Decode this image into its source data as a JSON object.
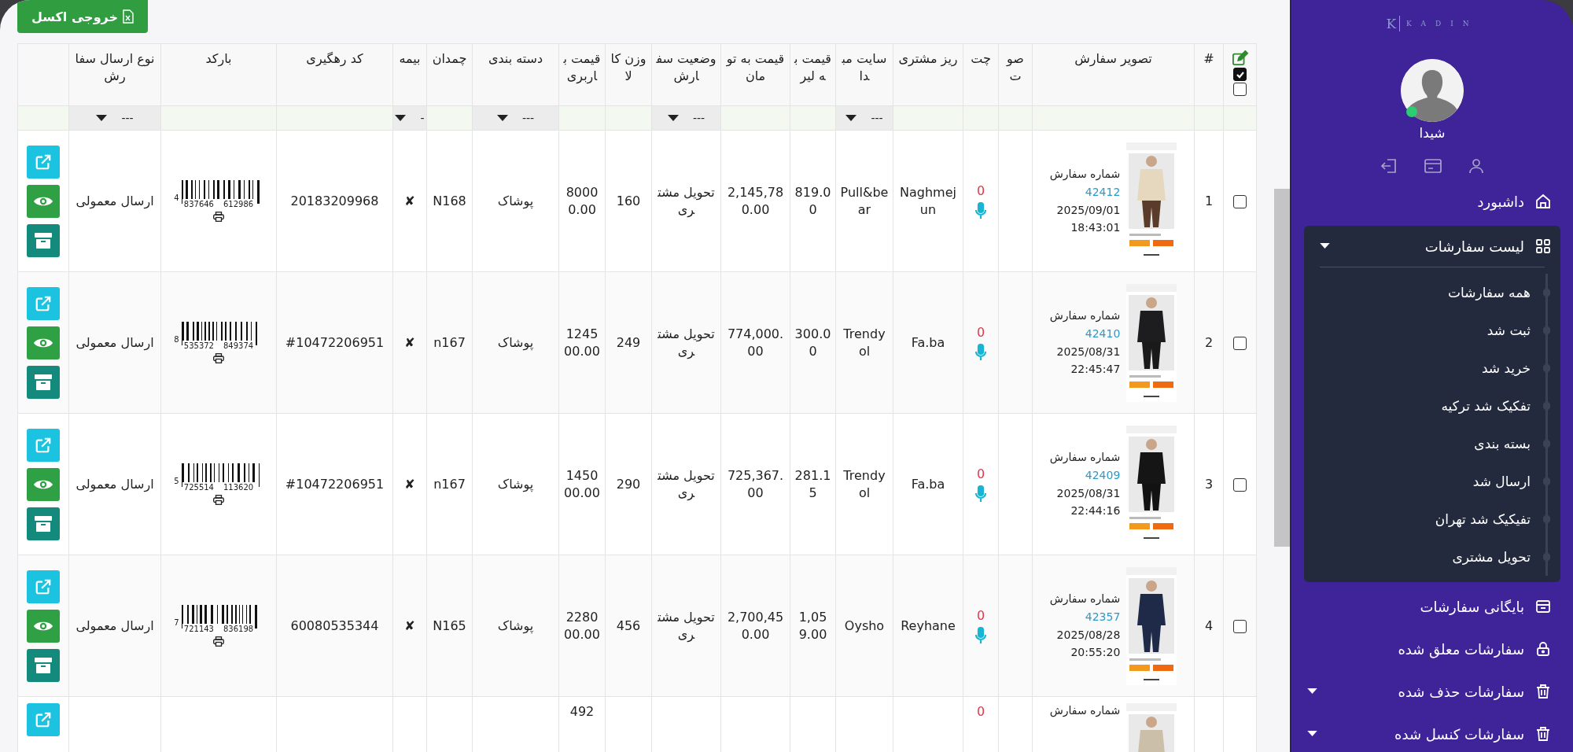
{
  "export_button": {
    "label": "خروجی اکسل"
  },
  "table": {
    "select_controls": [
      {
        "checked": true
      },
      {
        "checked": false
      }
    ],
    "columns": [
      {
        "label": "#"
      },
      {
        "label": "تصویر سفارش"
      },
      {
        "label": "صوت"
      },
      {
        "label": "چت"
      },
      {
        "label": "ریز مشتری"
      },
      {
        "label": "سایت مبدا",
        "filter": "---"
      },
      {
        "label": "قیمت به لیر"
      },
      {
        "label": "قیمت به تومان"
      },
      {
        "label": "وضعیت سفارش",
        "filter": "---"
      },
      {
        "label": "وزن کالا"
      },
      {
        "label": "قیمت باربری"
      },
      {
        "label": "دسته بندی",
        "filter": "---"
      },
      {
        "label": "چمدان"
      },
      {
        "label": "بیمه",
        "filter": "-"
      },
      {
        "label": "کد رهگیری"
      },
      {
        "label": "بارکد"
      },
      {
        "label": "نوع ارسال سفارش",
        "filter": "---"
      }
    ],
    "rows": [
      {
        "selected": false,
        "number": "1",
        "order_label": "شماره سفارش",
        "order_id": "42412",
        "date": "2025/09/01",
        "time": "18:43:01",
        "chat": "0",
        "customer": "Naghmejun",
        "site": "Pull&bear",
        "price_lira": "819.00",
        "price_toman": "2,145,780.00",
        "status": "تحویل مشتری",
        "weight": "160",
        "shipping_price": "80000.00",
        "category": "پوشاک",
        "suitcase": "N168",
        "insurance": "✘",
        "tracking": "20183209968",
        "barcode": [
          "4",
          "837646",
          "612986"
        ],
        "shipping_type": "ارسال معمولی"
      },
      {
        "selected": false,
        "number": "2",
        "order_label": "شماره سفارش",
        "order_id": "42410",
        "date": "2025/08/31",
        "time": "22:45:47",
        "chat": "0",
        "customer": "Fa.ba",
        "site": "Trendyol",
        "price_lira": "300.00",
        "price_toman": "774,000.00",
        "status": "تحویل مشتری",
        "weight": "249",
        "shipping_price": "124500.00",
        "category": "پوشاک",
        "suitcase": "n167",
        "insurance": "✘",
        "tracking": "#10472206951",
        "barcode": [
          "8",
          "535372",
          "849374"
        ],
        "shipping_type": "ارسال معمولی"
      },
      {
        "selected": false,
        "number": "3",
        "order_label": "شماره سفارش",
        "order_id": "42409",
        "date": "2025/08/31",
        "time": "22:44:16",
        "chat": "0",
        "customer": "Fa.ba",
        "site": "Trendyol",
        "price_lira": "281.15",
        "price_toman": "725,367.00",
        "status": "تحویل مشتری",
        "weight": "290",
        "shipping_price": "145000.00",
        "category": "پوشاک",
        "suitcase": "n167",
        "insurance": "✘",
        "tracking": "#10472206951",
        "barcode": [
          "5",
          "725514",
          "113620"
        ],
        "shipping_type": "ارسال معمولی"
      },
      {
        "selected": false,
        "number": "4",
        "order_label": "شماره سفارش",
        "order_id": "42357",
        "date": "2025/08/28",
        "time": "20:55:20",
        "chat": "0",
        "customer": "Reyhane",
        "site": "Oysho",
        "price_lira": "1,059.00",
        "price_toman": "2,700,450.00",
        "status": "تحویل مشتری",
        "weight": "456",
        "shipping_price": "228000.00",
        "category": "پوشاک",
        "suitcase": "N165",
        "insurance": "✘",
        "tracking": "60080535344",
        "barcode": [
          "7",
          "721143",
          "836198"
        ],
        "shipping_type": "ارسال معمولی"
      },
      {
        "order_label": "شماره سفارش",
        "chat": "0",
        "shipping_price": "492"
      }
    ]
  },
  "sidebar": {
    "logo": {
      "mark": "K",
      "name": "KADIN"
    },
    "user": {
      "name": "شیدا",
      "online": true
    },
    "menu": [
      {
        "label": "داشبورد"
      },
      {
        "label": "لیست سفارشات",
        "expanded": true,
        "children": [
          {
            "label": "همه سفارشات"
          },
          {
            "label": "ثبت شد"
          },
          {
            "label": "خرید شد"
          },
          {
            "label": "تفکیک شد ترکیه"
          },
          {
            "label": "بسته بندی"
          },
          {
            "label": "ارسال شد"
          },
          {
            "label": "تفیکیک شد تهران"
          },
          {
            "label": "تحویل مشتری"
          }
        ]
      },
      {
        "label": "بایگانی سفارشات"
      },
      {
        "label": "سفارشات معلق شده"
      },
      {
        "label": "سفارشات حذف شده",
        "expanded": false
      },
      {
        "label": "سفارشات کنسل شده",
        "expanded": false
      }
    ]
  }
}
